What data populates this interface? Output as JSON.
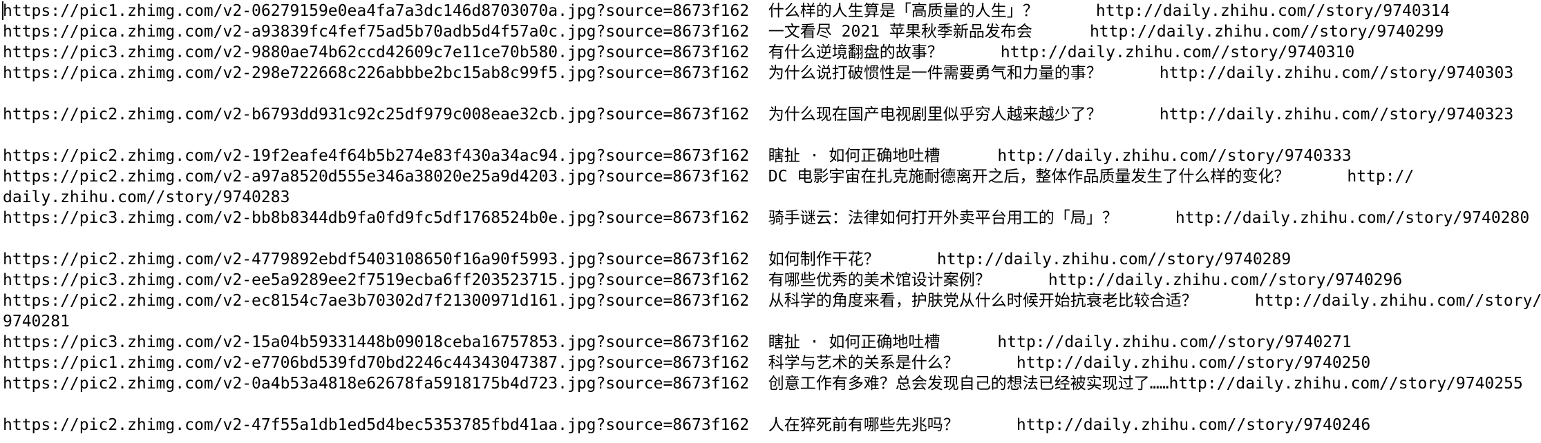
{
  "lines": [
    "https://pic1.zhimg.com/v2-06279159e0ea4fa7a3dc146d8703070a.jpg?source=8673f162  什么样的人生算是「高质量的人生」？      http://daily.zhihu.com//story/9740314",
    "https://pica.zhimg.com/v2-a93839fc4fef75ad5b70adb5d4f57a0c.jpg?source=8673f162  一文看尽 2021 苹果秋季新品发布会      http://daily.zhihu.com//story/9740299",
    "https://pic3.zhimg.com/v2-9880ae74b62ccd42609c7e11ce70b580.jpg?source=8673f162  有什么逆境翻盘的故事？      http://daily.zhihu.com//story/9740310",
    "https://pica.zhimg.com/v2-298e722668c226abbbe2bc15ab8c99f5.jpg?source=8673f162  为什么说打破惯性是一件需要勇气和力量的事？      http://daily.zhihu.com//story/9740303",
    "",
    "https://pic2.zhimg.com/v2-b6793dd931c92c25df979c008eae32cb.jpg?source=8673f162  为什么现在国产电视剧里似乎穷人越来越少了？      http://daily.zhihu.com//story/9740323",
    "",
    "https://pic2.zhimg.com/v2-19f2eafe4f64b5b274e83f430a34ac94.jpg?source=8673f162  瞎扯 · 如何正确地吐槽      http://daily.zhihu.com//story/9740333",
    "https://pic2.zhimg.com/v2-a97a8520d555e346a38020e25a9d4203.jpg?source=8673f162  DC 电影宇宙在扎克施耐德离开之后，整体作品质量发生了什么样的变化？      http://",
    "daily.zhihu.com//story/9740283",
    "https://pic3.zhimg.com/v2-bb8b8344db9fa0fd9fc5df1768524b0e.jpg?source=8673f162  骑手谜云：法律如何打开外卖平台用工的「局」？      http://daily.zhihu.com//story/9740280",
    "",
    "https://pic2.zhimg.com/v2-4779892ebdf5403108650f16a90f5993.jpg?source=8673f162  如何制作干花？      http://daily.zhihu.com//story/9740289",
    "https://pic3.zhimg.com/v2-ee5a9289ee2f7519ecba6ff203523715.jpg?source=8673f162  有哪些优秀的美术馆设计案例？      http://daily.zhihu.com//story/9740296",
    "https://pic2.zhimg.com/v2-ec8154c7ae3b70302d7f21300971d161.jpg?source=8673f162  从科学的角度来看，护肤党从什么时候开始抗衰老比较合适？      http://daily.zhihu.com//story/",
    "9740281",
    "https://pic3.zhimg.com/v2-15a04b59331448b09018ceba16757853.jpg?source=8673f162  瞎扯 · 如何正确地吐槽      http://daily.zhihu.com//story/9740271",
    "https://pic1.zhimg.com/v2-e7706bd539fd70bd2246c44343047387.jpg?source=8673f162  科学与艺术的关系是什么？      http://daily.zhihu.com//story/9740250",
    "https://pic2.zhimg.com/v2-0a4b53a4818e62678fa5918175b4d723.jpg?source=8673f162  创意工作有多难？总会发现自己的想法已经被实现过了……http://daily.zhihu.com//story/9740255",
    "",
    "https://pic2.zhimg.com/v2-47f55a1db1ed5d4bec5353785fbd41aa.jpg?source=8673f162  人在猝死前有哪些先兆吗？      http://daily.zhihu.com//story/9740246"
  ]
}
